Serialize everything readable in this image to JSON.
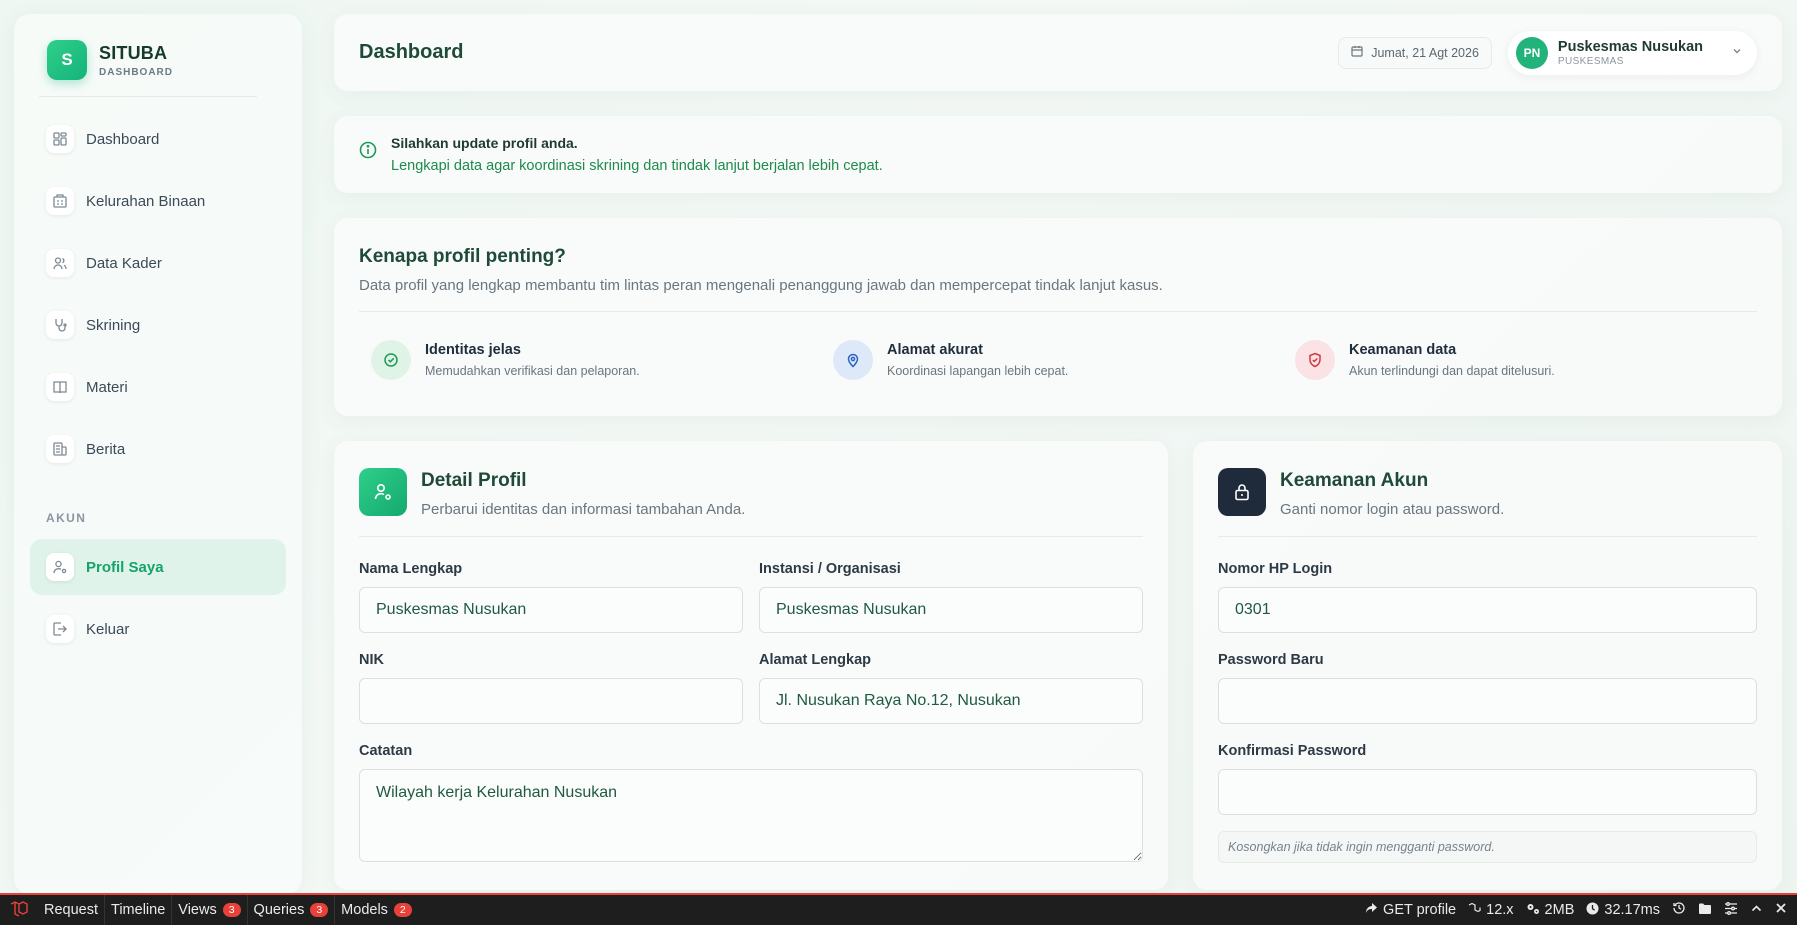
{
  "brand": {
    "logo_letter": "S",
    "name": "SITUBA",
    "sub": "DASHBOARD"
  },
  "sidebar": {
    "items": [
      {
        "label": "Dashboard",
        "icon": "grid-icon"
      },
      {
        "label": "Kelurahan Binaan",
        "icon": "map-icon"
      },
      {
        "label": "Data Kader",
        "icon": "users-icon"
      },
      {
        "label": "Skrining",
        "icon": "stethoscope-icon"
      },
      {
        "label": "Materi",
        "icon": "book-icon"
      },
      {
        "label": "Berita",
        "icon": "newspaper-icon"
      }
    ],
    "section_label": "AKUN",
    "account_items": [
      {
        "label": "Profil Saya",
        "icon": "user-gear-icon",
        "active": true
      },
      {
        "label": "Keluar",
        "icon": "logout-icon"
      }
    ]
  },
  "header": {
    "title": "Dashboard",
    "date": "Jumat, 21 Agt 2026",
    "user": {
      "initials": "PN",
      "name": "Puskesmas Nusukan",
      "role": "PUSKESMAS"
    }
  },
  "alert": {
    "title": "Silahkan update profil anda.",
    "text": "Lengkapi data agar koordinasi skrining dan tindak lanjut berjalan lebih cepat."
  },
  "info": {
    "title": "Kenapa profil penting?",
    "desc": "Data profil yang lengkap membantu tim lintas peran mengenali penanggung jawab dan mempercepat tindak lanjut kasus.",
    "features": [
      {
        "title": "Identitas jelas",
        "desc": "Memudahkan verifikasi dan pelaporan.",
        "icon": "check-circle-icon"
      },
      {
        "title": "Alamat akurat",
        "desc": "Koordinasi lapangan lebih cepat.",
        "icon": "map-pin-icon"
      },
      {
        "title": "Keamanan data",
        "desc": "Akun terlindungi dan dapat ditelusuri.",
        "icon": "shield-check-icon"
      }
    ]
  },
  "profile": {
    "title": "Detail Profil",
    "sub": "Perbarui identitas dan informasi tambahan Anda.",
    "fields": {
      "nama_label": "Nama Lengkap",
      "nama_value": "Puskesmas Nusukan",
      "instansi_label": "Instansi / Organisasi",
      "instansi_value": "Puskesmas Nusukan",
      "nik_label": "NIK",
      "nik_value": "",
      "alamat_label": "Alamat Lengkap",
      "alamat_value": "Jl. Nusukan Raya No.12, Nusukan",
      "catatan_label": "Catatan",
      "catatan_value": "Wilayah kerja Kelurahan Nusukan"
    }
  },
  "security": {
    "title": "Keamanan Akun",
    "sub": "Ganti nomor login atau password.",
    "fields": {
      "hp_label": "Nomor HP Login",
      "hp_value": "0301",
      "pw_label": "Password Baru",
      "pw_value": "",
      "pw2_label": "Konfirmasi Password",
      "pw2_value": ""
    },
    "hint": "Kosongkan jika tidak ingin mengganti password."
  },
  "debugbar": {
    "tabs": [
      {
        "label": "Request"
      },
      {
        "label": "Timeline"
      },
      {
        "label": "Views",
        "badge": "3"
      },
      {
        "label": "Queries",
        "badge": "3"
      },
      {
        "label": "Models",
        "badge": "2"
      }
    ],
    "route": "GET profile",
    "version": "12.x",
    "memory": "2MB",
    "time": "32.17ms"
  },
  "colors": {
    "accent": "#16a36a",
    "brand": "#22b37a",
    "debug_red": "#e7413a"
  }
}
